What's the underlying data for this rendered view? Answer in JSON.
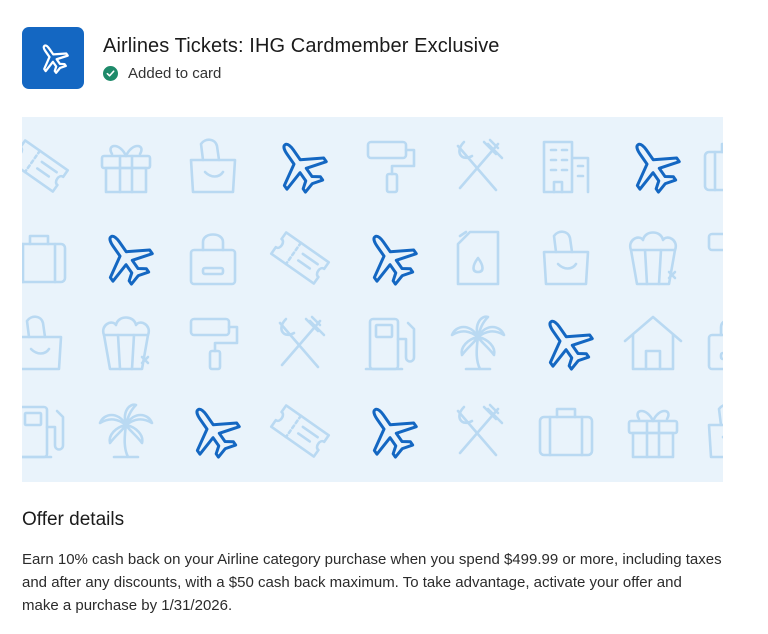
{
  "offer": {
    "title": "Airlines Tickets: IHG Cardmember Exclusive",
    "status": "Added to card",
    "icon": "airplane-icon",
    "brand_color": "#1467c2",
    "status_color": "#1e8a6a"
  },
  "banner": {
    "background_color": "#e9f3fb",
    "faded_icon_color": "#b9d9f2",
    "highlight_icon_color": "#1467c2",
    "rows": [
      [
        "ticket-icon",
        "gift-icon",
        "grocery-bag-icon",
        "airplane-icon",
        "paint-roller-icon",
        "utensils-icon",
        "building-icon",
        "airplane-icon",
        "suitcase-icon"
      ],
      [
        "suitcase-icon",
        "airplane-icon",
        "shopping-bag-icon",
        "ticket-icon",
        "airplane-icon",
        "fuel-can-icon",
        "grocery-bag-icon",
        "popcorn-icon",
        "paint-roller-icon"
      ],
      [
        "grocery-bag-icon",
        "popcorn-icon",
        "paint-roller-icon",
        "utensils-icon",
        "gas-pump-icon",
        "palm-tree-icon",
        "airplane-icon",
        "house-icon",
        "shopping-bag-icon"
      ],
      [
        "gas-pump-icon",
        "palm-tree-icon",
        "airplane-icon",
        "ticket-icon",
        "airplane-icon",
        "utensils-icon",
        "suitcase-icon",
        "gift-icon",
        "grocery-bag-icon"
      ]
    ]
  },
  "details": {
    "heading": "Offer details",
    "body": "Earn 10% cash back on your Airline category purchase when you spend $499.99 or more, including taxes and after any discounts, with a $50 cash back maximum. To take advantage, activate your offer and make a purchase by 1/31/2026."
  }
}
